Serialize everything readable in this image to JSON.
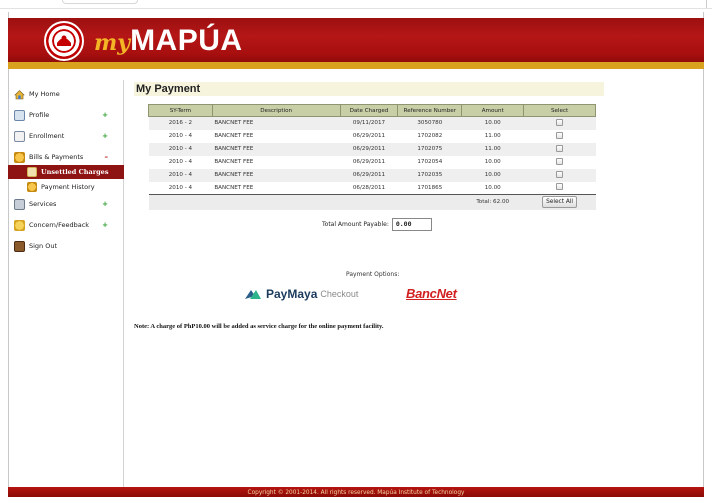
{
  "brand": {
    "prefix": "my",
    "name": "MAPÚA"
  },
  "sidebar": {
    "items": [
      {
        "label": "My Home",
        "mark": ""
      },
      {
        "label": "Profile",
        "mark": "+"
      },
      {
        "label": "Enrollment",
        "mark": "+"
      },
      {
        "label": "Bills & Payments",
        "mark": "–"
      },
      {
        "label": "Services",
        "mark": "+"
      },
      {
        "label": "Concern/Feedback",
        "mark": "+"
      },
      {
        "label": "Sign Out",
        "mark": ""
      }
    ],
    "subitems": [
      {
        "label": "Unsettled Charges"
      },
      {
        "label": "Payment History"
      }
    ]
  },
  "main": {
    "title": "My Payment",
    "table": {
      "headers": [
        "SY-Term",
        "Description",
        "Date Charged",
        "Reference Number",
        "Amount",
        "Select"
      ],
      "rows": [
        [
          "2016 - 2",
          "BANCNET FEE",
          "09/11/2017",
          "3050780",
          "10.00"
        ],
        [
          "2010 - 4",
          "BANCNET FEE",
          "06/29/2011",
          "1702082",
          "11.00"
        ],
        [
          "2010 - 4",
          "BANCNET FEE",
          "06/29/2011",
          "1702075",
          "11.00"
        ],
        [
          "2010 - 4",
          "BANCNET FEE",
          "06/29/2011",
          "1702054",
          "10.00"
        ],
        [
          "2010 - 4",
          "BANCNET FEE",
          "06/29/2011",
          "1702035",
          "10.00"
        ],
        [
          "2010 - 4",
          "BANCNET FEE",
          "06/28/2011",
          "1701865",
          "10.00"
        ]
      ],
      "total_label": "Total: 62.00",
      "select_all": "Select All"
    },
    "total_payable_label": "Total Amount Payable:",
    "total_payable_value": "0.00",
    "payment_options_label": "Payment Options:",
    "paymaya_label": "PayMaya",
    "paymaya_checkout": "Checkout",
    "bancnet_label": "BancNet",
    "note": "Note: A charge of PhP10.00 will be added as service charge for the online payment facility."
  },
  "footer": {
    "text": "Copyright © 2001-2014. All rights reserved. Mapúa Institute of Technology"
  },
  "colors": {
    "header_red": "#a80f0f",
    "gold": "#d9a21e",
    "active_nav": "#8e1414",
    "table_header": "#c8cfa7"
  }
}
